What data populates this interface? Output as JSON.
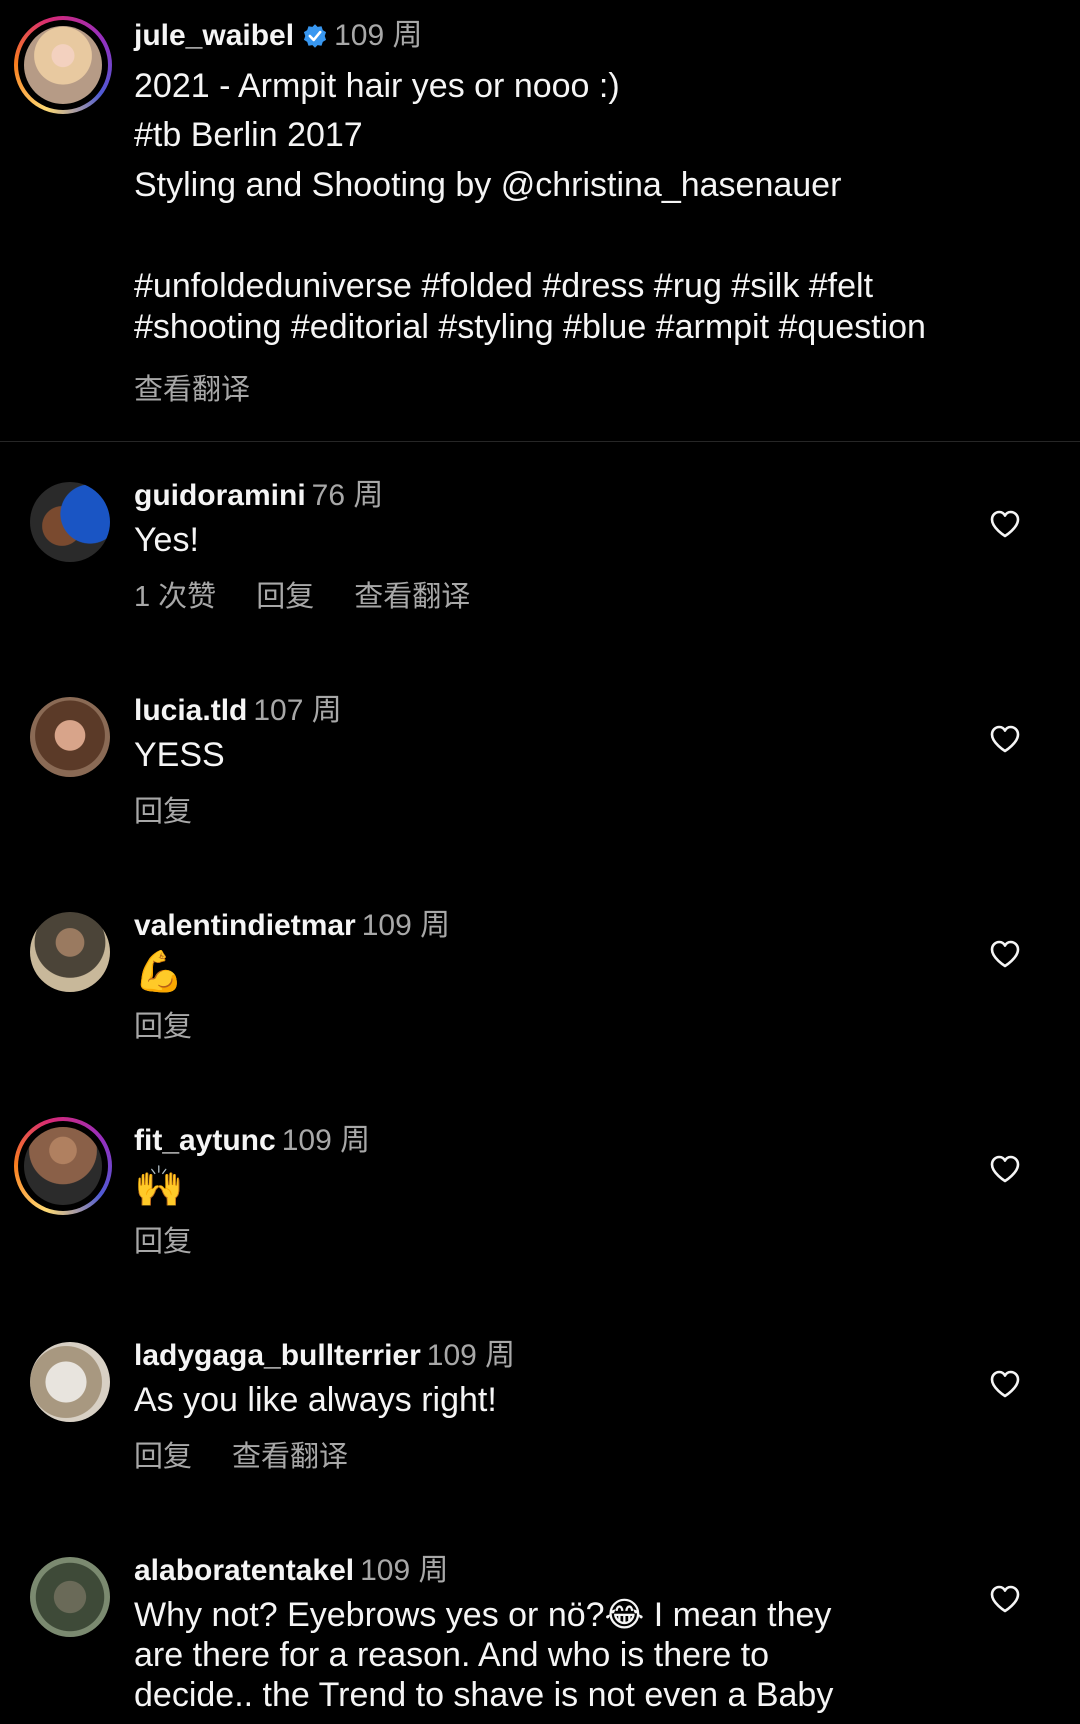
{
  "post": {
    "username": "jule_waibel",
    "verified_icon": "verified-badge-icon",
    "time": "109 周",
    "caption_lines": [
      "2021 - Armpit hair yes or nooo :)",
      "#tb Berlin 2017",
      "Styling and Shooting by @christina_hasenauer",
      "#unfoldeduniverse #folded #dress #rug #silk #felt",
      "#shooting #editorial #styling #blue #armpit #question"
    ],
    "translate_label": "查看翻译"
  },
  "comments": [
    {
      "username": "guidoramini",
      "time": "76 周",
      "text": "Yes!",
      "likes": "1 次赞",
      "reply": "回复",
      "translate": "查看翻译"
    },
    {
      "username": "lucia.tld",
      "time": "107 周",
      "text": "YESS",
      "reply": "回复"
    },
    {
      "username": "valentindietmar",
      "time": "109 周",
      "text": "💪",
      "reply": "回复"
    },
    {
      "username": "fit_aytunc",
      "time": "109 周",
      "text": "🙌",
      "reply": "回复"
    },
    {
      "username": "ladygaga_bullterrier",
      "time": "109 周",
      "text": "As you like always right!",
      "reply": "回复",
      "translate": "查看翻译"
    },
    {
      "username": "alaboratentakel",
      "time": "109 周",
      "text_lines": [
        "Why not? Eyebrows yes or nö?😂 I mean they",
        "are there for a reason. And who is there to",
        "decide.. the Trend to shave is not even a  Baby"
      ]
    }
  ],
  "colors": {
    "background": "#000000",
    "text": "#f5f5f5",
    "secondary": "#a8a8a8",
    "verified": "#3897f0"
  }
}
